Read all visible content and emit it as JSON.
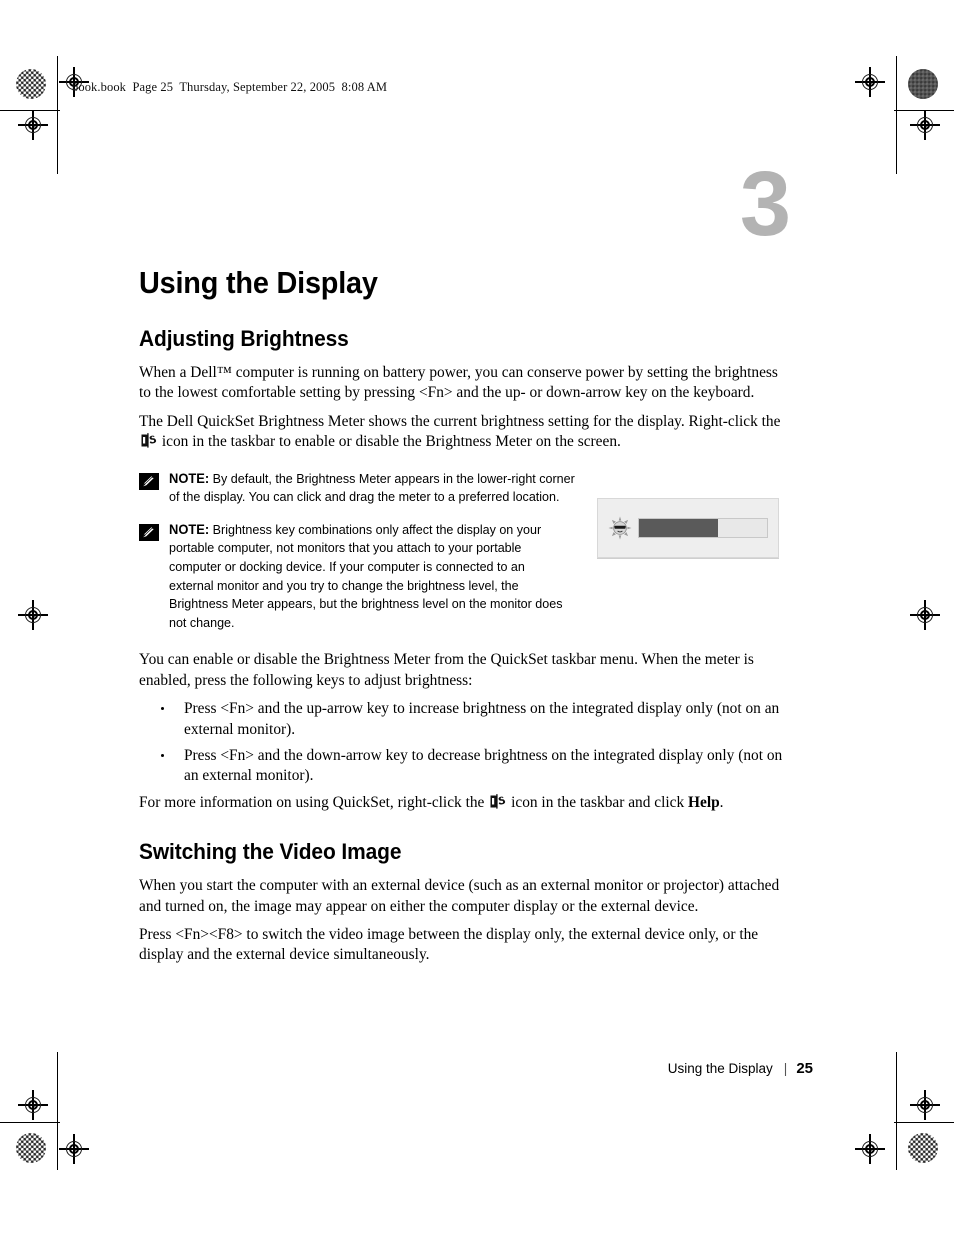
{
  "print_header": {
    "text": "book.book  Page 25  Thursday, September 22, 2005  8:08 AM"
  },
  "chapter": {
    "number": "3",
    "title": "Using the Display"
  },
  "sections": [
    {
      "heading": "Adjusting Brightness",
      "paragraph_1": "When a Dell™ computer is running on battery power, you can conserve power by setting the brightness to the lowest comfortable setting by pressing <Fn> and the up- or down-arrow key on the keyboard.",
      "paragraph_2_before_icon": "The Dell QuickSet Brightness Meter shows the current brightness setting for the display. Right-click the ",
      "paragraph_2_after_icon": " icon in the taskbar to enable or disable the Brightness Meter on the screen.",
      "paragraph_3": "You can enable or disable the Brightness Meter from the QuickSet taskbar menu. When the meter is enabled, press the following keys to adjust brightness:",
      "bullets": [
        "Press <Fn> and the up-arrow key to increase brightness on the integrated display only (not on an external monitor).",
        "Press <Fn> and the down-arrow key to decrease brightness on the integrated display only (not on an external monitor)."
      ],
      "paragraph_4_before_icon": "For more information on using QuickSet, right-click the ",
      "paragraph_4_mid": " icon in the taskbar and click ",
      "paragraph_4_bold": "Help",
      "paragraph_4_end": "."
    },
    {
      "heading": "Switching the Video Image",
      "paragraph_1": "When you start the computer with an external device (such as an external monitor or projector) attached and turned on, the image may appear on either the computer display or the external device.",
      "paragraph_2": "Press <Fn><F8> to switch the video image between the display only, the external device only, or the display and the external device simultaneously."
    }
  ],
  "notes": [
    {
      "label": "NOTE:",
      "text": " By default, the Brightness Meter appears in the lower-right corner of the display. You can click and drag the meter to a preferred location."
    },
    {
      "label": "NOTE:",
      "text": " Brightness key combinations only affect the display on your portable computer, not monitors that you attach to your portable computer or docking device. If your computer is connected to an external monitor and you try to change the brightness level, the Brightness Meter appears, but the brightness level on the monitor does not change."
    }
  ],
  "brightness_meter_figure": {
    "icon_name": "sun-brightness-icon",
    "fill_percent": "62%",
    "panel_color": "#eeeeee",
    "fill_color": "#5a5a5a",
    "track_color": "#e8e8e8"
  },
  "footer": {
    "running_title": "Using the Display",
    "separator": "|",
    "page_number": "25"
  },
  "colors": {
    "chapter_number": "#b3b3b3",
    "text": "#000000",
    "page_background": "#ffffff"
  }
}
